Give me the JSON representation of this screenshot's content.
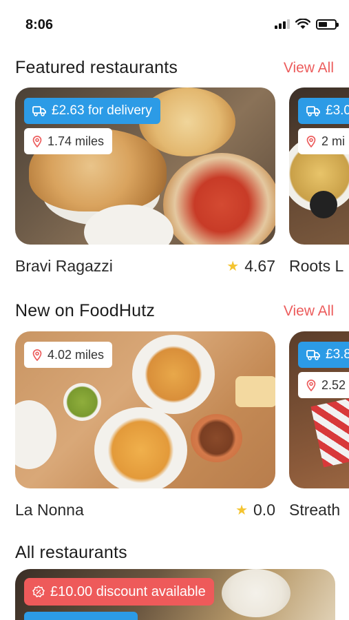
{
  "status_bar": {
    "time": "8:06"
  },
  "featured": {
    "title": "Featured restaurants",
    "view_all": "View All",
    "cards": [
      {
        "name": "Bravi Ragazzi",
        "delivery": "£2.63 for delivery",
        "distance": "1.74 miles",
        "rating": "4.67"
      },
      {
        "name": "Roots L",
        "delivery": "£3.0",
        "distance": "2 mi"
      }
    ]
  },
  "new_on": {
    "title": "New on FoodHutz",
    "view_all": "View All",
    "cards": [
      {
        "name": "La Nonna",
        "distance": "4.02 miles",
        "rating": "0.0"
      },
      {
        "name": "Streath",
        "delivery": "£3.8",
        "distance": "2.52"
      }
    ]
  },
  "all_restaurants": {
    "title": "All restaurants",
    "discount": "£10.00 discount available"
  },
  "icons": {
    "delivery": "delivery-van-icon",
    "distance": "map-pin-icon",
    "rating": "star-icon",
    "discount": "discount-badge-icon"
  },
  "colors": {
    "accent_red": "#ec5c5c",
    "delivery_blue": "#2c9be6",
    "discount_red": "#ee5a5a",
    "star_yellow": "#f4c430"
  }
}
